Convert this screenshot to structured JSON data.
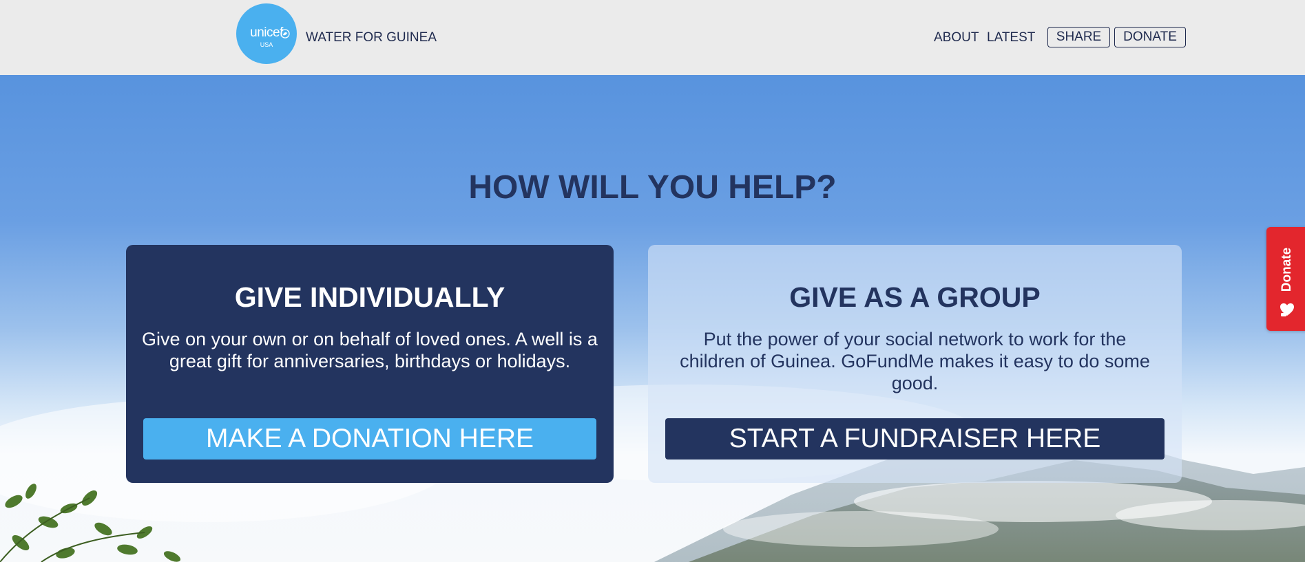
{
  "header": {
    "logo": {
      "word": "unicef",
      "sub": "USA"
    },
    "site_title": "WATER FOR GUINEA",
    "nav": {
      "about": "ABOUT",
      "latest": "LATEST",
      "share": "SHARE",
      "donate": "DONATE"
    }
  },
  "hero": {
    "title": "HOW WILL YOU HELP?"
  },
  "cards": {
    "individual": {
      "title": "GIVE INDIVIDUALLY",
      "text": "Give on your own or on behalf of loved ones. A well is a great gift for anniversaries, birthdays or holidays.",
      "button": "MAKE A DONATION HERE"
    },
    "group": {
      "title": "GIVE AS A GROUP",
      "text": "Put the power of your social network to work for the children of Guinea. GoFundMe makes it easy to do some good.",
      "button": "START A FUNDRAISER HERE"
    }
  },
  "donate_tab": {
    "label": "Donate",
    "icon": "heart-hand-icon"
  },
  "colors": {
    "navy": "#23345f",
    "unicef_blue": "#4ab0ef",
    "donate_red": "#e3262d",
    "header_bg": "#ebebeb"
  }
}
